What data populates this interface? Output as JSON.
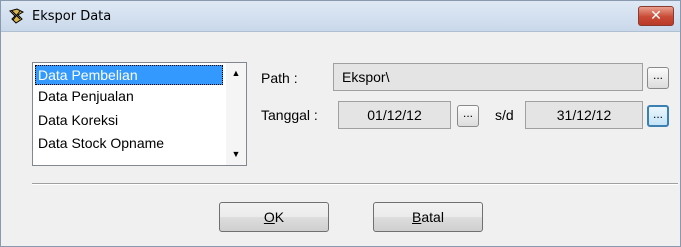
{
  "window": {
    "title": "Ekspor Data",
    "close_label": "✕"
  },
  "list": {
    "items": [
      "Data Pembelian",
      "Data Penjualan",
      "Data Koreksi",
      "Data Stock Opname"
    ],
    "selected_index": 0
  },
  "path": {
    "label": "Path :",
    "value": "Ekspor\\",
    "browse_label": "..."
  },
  "tanggal": {
    "label": "Tanggal :",
    "from": "01/12/12",
    "sd_label": "s/d",
    "to": "31/12/12",
    "picker_label": "..."
  },
  "buttons": {
    "ok": {
      "mnemonic": "O",
      "rest": "K"
    },
    "batal": {
      "mnemonic": "B",
      "rest": "atal"
    }
  }
}
